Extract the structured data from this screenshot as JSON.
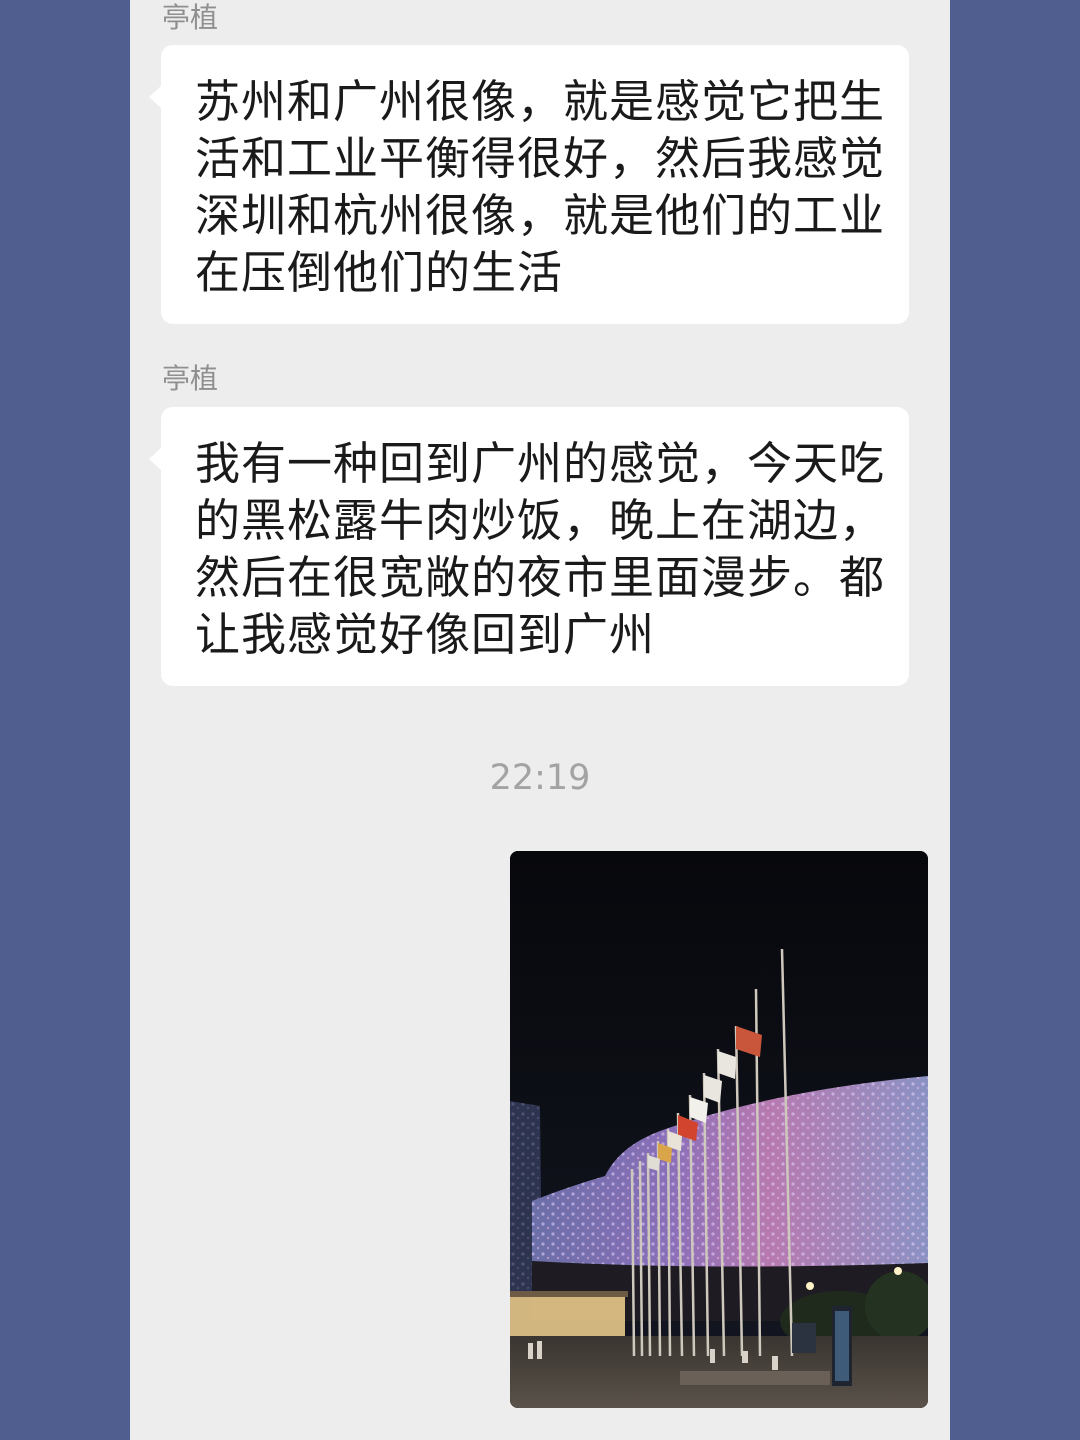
{
  "chat": {
    "messages": [
      {
        "sender": "亭植",
        "lines": [
          "苏州和广州很像，就是感觉它把生",
          "活和工业平衡得很好，然后我感觉",
          "深圳和杭州很像，就是他们的工业",
          "在压倒他们的生活"
        ]
      },
      {
        "sender": "亭植",
        "lines": [
          "我有一种回到广州的感觉，今天吃",
          "的黑松露牛肉炒饭，晚上在湖边，",
          "然后在很宽敞的夜市里面漫步。都",
          "让我感觉好像回到广州"
        ]
      }
    ],
    "timestamp": "22:19"
  }
}
